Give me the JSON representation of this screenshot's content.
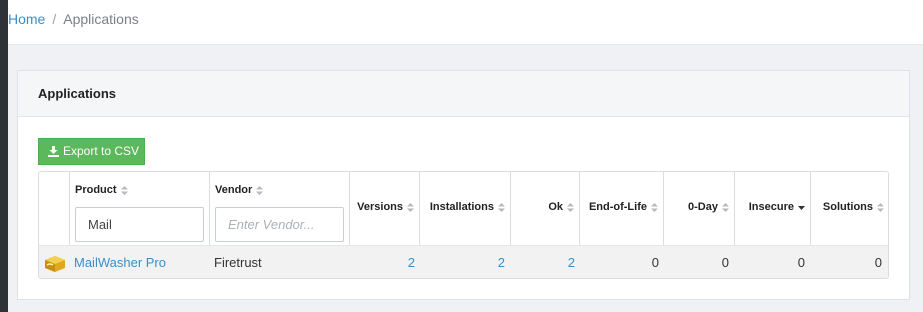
{
  "breadcrumb": {
    "home": "Home",
    "separator": "/",
    "current": "Applications"
  },
  "panel": {
    "title": "Applications"
  },
  "toolbar": {
    "export_label": "Export to CSV"
  },
  "table": {
    "columns": {
      "product": "Product",
      "vendor": "Vendor",
      "versions": "Versions",
      "installations": "Installations",
      "ok": "Ok",
      "eol": "End-of-Life",
      "zeroday": "0-Day",
      "insecure": "Insecure",
      "solutions": "Solutions"
    },
    "filters": {
      "product_value": "Mail",
      "vendor_placeholder": "Enter Vendor..."
    },
    "rows": [
      {
        "product": "MailWasher Pro",
        "vendor": "Firetrust",
        "versions": "2",
        "installations": "2",
        "ok": "2",
        "eol": "0",
        "zeroday": "0",
        "insecure": "0",
        "solutions": "0"
      }
    ]
  },
  "colors": {
    "link": "#3a8fc9",
    "export_button": "#5cb85c",
    "row_bg": "#f2f2f2"
  }
}
